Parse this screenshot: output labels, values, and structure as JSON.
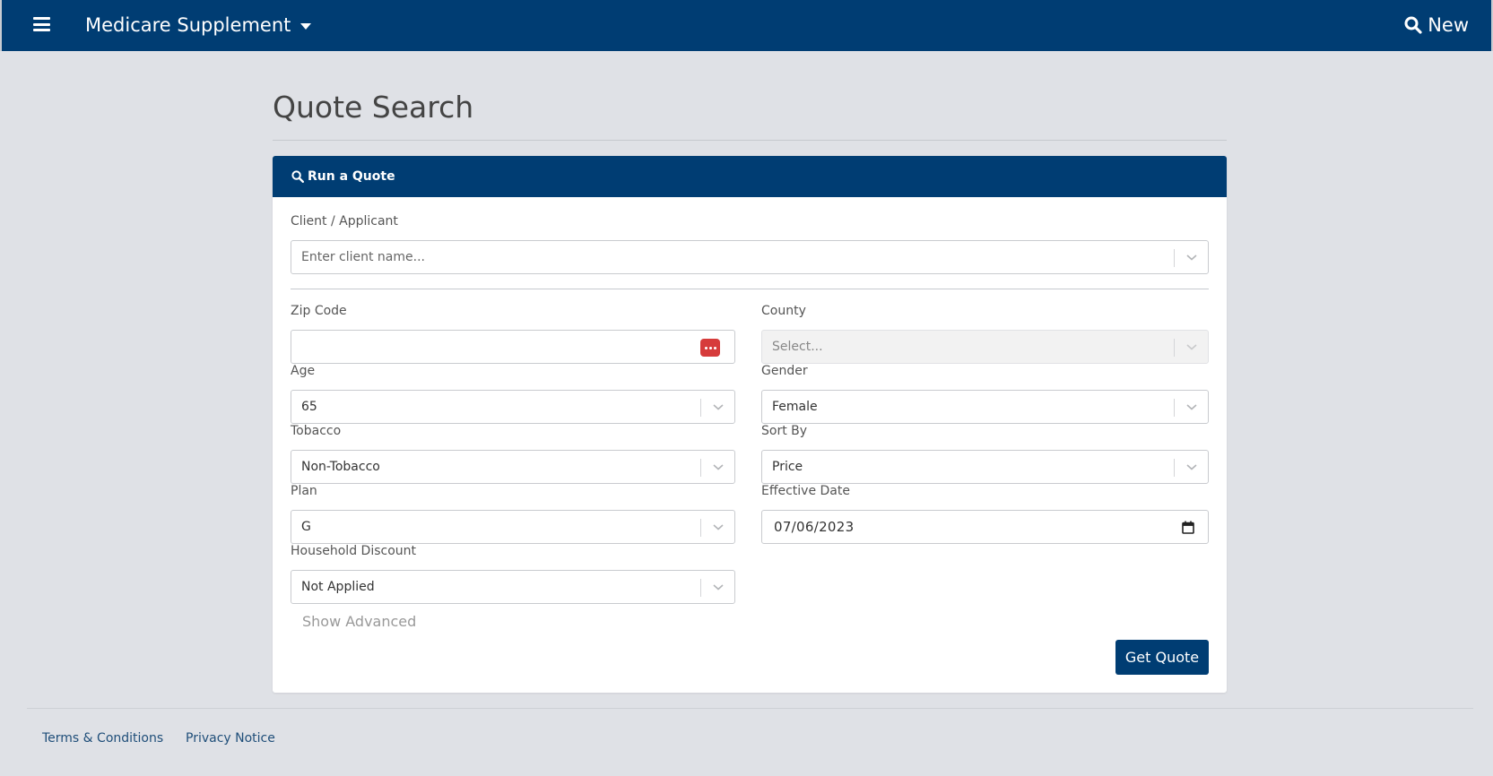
{
  "navbar": {
    "menu_icon": "hamburger-menu-icon",
    "product": "Medicare Supplement",
    "product_caret_icon": "caret-down-icon",
    "new_icon": "search-icon",
    "new_label": "New"
  },
  "page": {
    "title": "Quote Search"
  },
  "card": {
    "header_icon": "search-icon",
    "header_title": "Run a Quote"
  },
  "form": {
    "client": {
      "label": "Client / Applicant",
      "placeholder": "Enter client name..."
    },
    "zip": {
      "label": "Zip Code",
      "value": "",
      "autofill_icon": "password-manager-icon"
    },
    "county": {
      "label": "County",
      "placeholder": "Select...",
      "disabled": true
    },
    "age": {
      "label": "Age",
      "value": "65"
    },
    "gender": {
      "label": "Gender",
      "value": "Female"
    },
    "tobacco": {
      "label": "Tobacco",
      "value": "Non-Tobacco"
    },
    "sort_by": {
      "label": "Sort By",
      "value": "Price"
    },
    "plan": {
      "label": "Plan",
      "value": "G"
    },
    "effective_date": {
      "label": "Effective Date",
      "value": "07/06/2023",
      "icon": "calendar-icon"
    },
    "household_discount": {
      "label": "Household Discount",
      "value": "Not Applied"
    },
    "show_advanced": "Show Advanced",
    "submit": "Get Quote"
  },
  "footer": {
    "terms": "Terms & Conditions",
    "privacy": "Privacy Notice"
  },
  "colors": {
    "primary": "#003d73",
    "background": "#dfe1e6",
    "autofill": "#d63b3b"
  }
}
